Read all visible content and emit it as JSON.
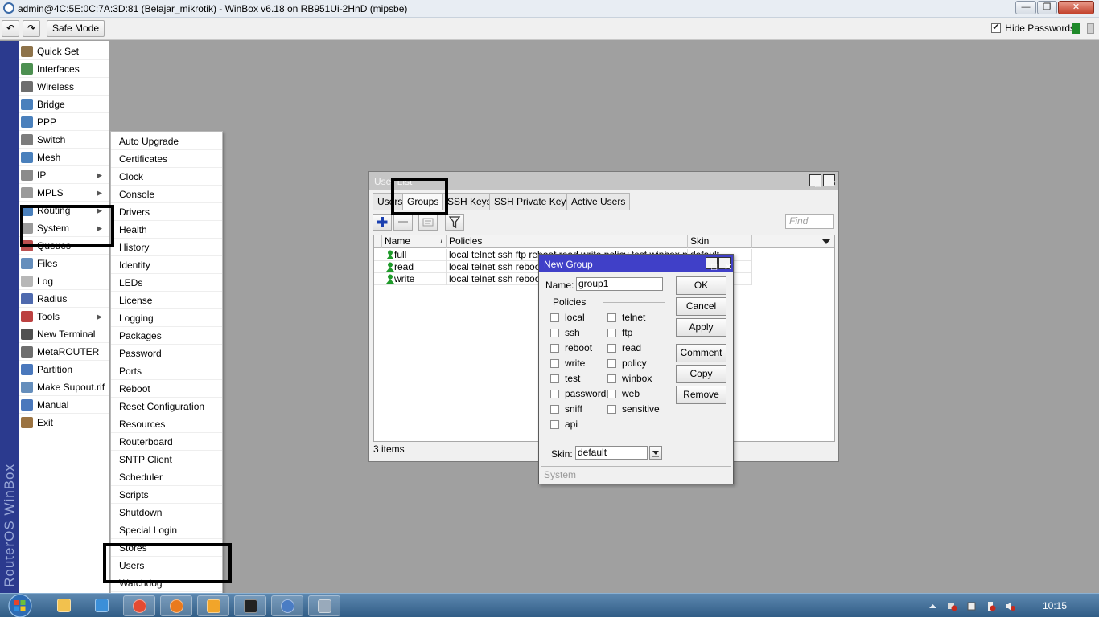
{
  "window": {
    "title": "admin@4C:5E:0C:7A:3D:81 (Belajar_mikrotik) - WinBox v6.18 on RB951Ui-2HnD (mipsbe)"
  },
  "toolbar": {
    "safe_mode": "Safe Mode",
    "hide_passwords": "Hide Passwords",
    "undo_icon": "undo-icon",
    "redo_icon": "redo-icon"
  },
  "banner": {
    "text": "RouterOS WinBox"
  },
  "main_menu": [
    {
      "label": "Quick Set",
      "icon": "quick-set-icon"
    },
    {
      "label": "Interfaces",
      "icon": "interfaces-icon"
    },
    {
      "label": "Wireless",
      "icon": "wireless-icon"
    },
    {
      "label": "Bridge",
      "icon": "bridge-icon"
    },
    {
      "label": "PPP",
      "icon": "ppp-icon"
    },
    {
      "label": "Switch",
      "icon": "switch-icon"
    },
    {
      "label": "Mesh",
      "icon": "mesh-icon"
    },
    {
      "label": "IP",
      "icon": "ip-icon",
      "submenu": true
    },
    {
      "label": "MPLS",
      "icon": "mpls-icon",
      "submenu": true
    },
    {
      "label": "Routing",
      "icon": "routing-icon",
      "submenu": true
    },
    {
      "label": "System",
      "icon": "system-icon",
      "submenu": true
    },
    {
      "label": "Queues",
      "icon": "queues-icon"
    },
    {
      "label": "Files",
      "icon": "files-icon"
    },
    {
      "label": "Log",
      "icon": "log-icon"
    },
    {
      "label": "Radius",
      "icon": "radius-icon"
    },
    {
      "label": "Tools",
      "icon": "tools-icon",
      "submenu": true
    },
    {
      "label": "New Terminal",
      "icon": "terminal-icon"
    },
    {
      "label": "MetaROUTER",
      "icon": "metarouter-icon"
    },
    {
      "label": "Partition",
      "icon": "partition-icon"
    },
    {
      "label": "Make Supout.rif",
      "icon": "supout-icon"
    },
    {
      "label": "Manual",
      "icon": "manual-icon"
    },
    {
      "label": "Exit",
      "icon": "exit-icon"
    }
  ],
  "system_submenu": [
    "Auto Upgrade",
    "Certificates",
    "Clock",
    "Console",
    "Drivers",
    "Health",
    "History",
    "Identity",
    "LEDs",
    "License",
    "Logging",
    "Packages",
    "Password",
    "Ports",
    "Reboot",
    "Reset Configuration",
    "Resources",
    "Routerboard",
    "SNTP Client",
    "Scheduler",
    "Scripts",
    "Shutdown",
    "Special Login",
    "Stores",
    "Users",
    "Watchdog"
  ],
  "user_list": {
    "title": "User List",
    "tabs": [
      "Users",
      "Groups",
      "SSH Keys",
      "SSH Private Keys",
      "Active Users"
    ],
    "active_tab": "Groups",
    "find_placeholder": "Find",
    "columns": [
      "Name",
      "Policies",
      "Skin"
    ],
    "rows": [
      {
        "name": "full",
        "policies": "local telnet ssh ftp reboot read write policy test winbox passw",
        "skin": "default"
      },
      {
        "name": "read",
        "policies": "local telnet ssh reboot re",
        "skin": ""
      },
      {
        "name": "write",
        "policies": "local telnet ssh reboot re",
        "skin": ""
      }
    ],
    "status": "3 items"
  },
  "new_group": {
    "title": "New Group",
    "name_label": "Name:",
    "name_value": "group1",
    "policies_label": "Policies",
    "policies_left": [
      "local",
      "ssh",
      "reboot",
      "write",
      "test",
      "password",
      "sniff",
      "api"
    ],
    "policies_right": [
      "telnet",
      "ftp",
      "read",
      "policy",
      "winbox",
      "web",
      "sensitive"
    ],
    "skin_label": "Skin:",
    "skin_value": "default",
    "buttons": [
      "OK",
      "Cancel",
      "Apply",
      "Comment",
      "Copy",
      "Remove"
    ],
    "footer": "System"
  },
  "taskbar": {
    "clock": "10:15",
    "apps": [
      "explorer-icon",
      "ie-icon",
      "chrome-icon",
      "firefox-icon",
      "media-player-icon",
      "cmd-icon",
      "winbox-icon",
      "paint-icon"
    ]
  },
  "colors": {
    "banner": "#2b3a8e",
    "dialog_title": "#4040c8",
    "desktop": "#a0a0a0"
  }
}
